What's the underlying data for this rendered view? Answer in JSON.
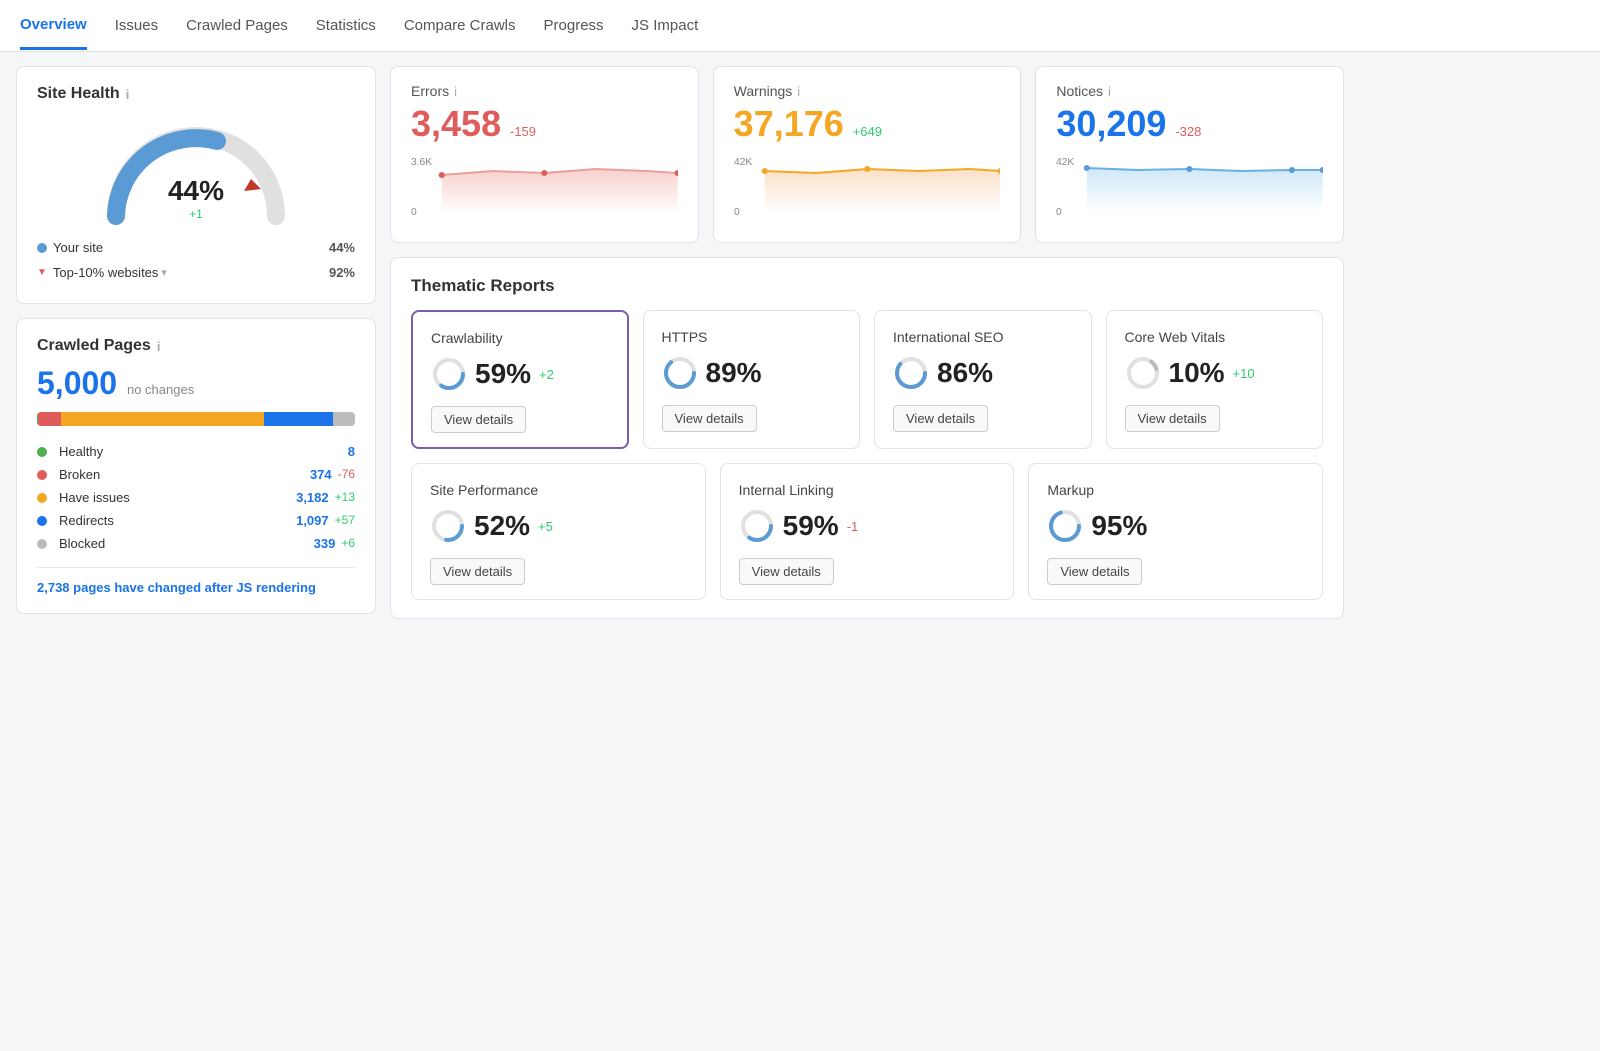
{
  "nav": {
    "items": [
      {
        "label": "Overview",
        "active": true
      },
      {
        "label": "Issues",
        "active": false
      },
      {
        "label": "Crawled Pages",
        "active": false
      },
      {
        "label": "Statistics",
        "active": false
      },
      {
        "label": "Compare Crawls",
        "active": false
      },
      {
        "label": "Progress",
        "active": false
      },
      {
        "label": "JS Impact",
        "active": false
      }
    ]
  },
  "site_health": {
    "title": "Site Health",
    "info": "i",
    "percent": "44%",
    "change": "+1",
    "your_site_label": "Your site",
    "your_site_val": "44%",
    "top10_label": "Top-10% websites",
    "top10_val": "92%"
  },
  "crawled_pages": {
    "title": "Crawled Pages",
    "info": "i",
    "total": "5,000",
    "no_changes": "no changes",
    "stats": [
      {
        "label": "Healthy",
        "color": "#4caf50",
        "value": "8",
        "delta": "",
        "delta_type": ""
      },
      {
        "label": "Broken",
        "color": "#e05c5c",
        "value": "374",
        "delta": "-76",
        "delta_type": "neg"
      },
      {
        "label": "Have issues",
        "color": "#f5a623",
        "value": "3,182",
        "delta": "+13",
        "delta_type": "pos"
      },
      {
        "label": "Redirects",
        "color": "#1a73e8",
        "value": "1,097",
        "delta": "+57",
        "delta_type": "pos"
      },
      {
        "label": "Blocked",
        "color": "#bbb",
        "value": "339",
        "delta": "+6",
        "delta_type": "pos"
      }
    ],
    "changed_text": "2,738 pages",
    "changed_suffix": " have changed after JS rendering"
  },
  "metrics": [
    {
      "label": "Errors",
      "value": "3,458",
      "delta": "-159",
      "delta_type": "neg",
      "type": "errors",
      "chart_max": "3.6K",
      "chart_color": "#f8d0cc",
      "chart_line": "#e8a09a"
    },
    {
      "label": "Warnings",
      "value": "37,176",
      "delta": "+649",
      "delta_type": "pos",
      "type": "warnings",
      "chart_max": "42K",
      "chart_color": "#fae0c8",
      "chart_line": "#f5a623"
    },
    {
      "label": "Notices",
      "value": "30,209",
      "delta": "-328",
      "delta_type": "neg2",
      "type": "notices",
      "chart_max": "42K",
      "chart_color": "#d0e8f8",
      "chart_line": "#6ab0e0"
    }
  ],
  "thematic": {
    "title": "Thematic Reports",
    "reports_top": [
      {
        "name": "Crawlability",
        "pct": "59%",
        "delta": "+2",
        "delta_type": "pos",
        "active": true,
        "score": 59
      },
      {
        "name": "HTTPS",
        "pct": "89%",
        "delta": "",
        "delta_type": "",
        "active": false,
        "score": 89
      },
      {
        "name": "International SEO",
        "pct": "86%",
        "delta": "",
        "delta_type": "",
        "active": false,
        "score": 86
      },
      {
        "name": "Core Web Vitals",
        "pct": "10%",
        "delta": "+10",
        "delta_type": "pos",
        "active": false,
        "score": 10
      }
    ],
    "reports_bottom": [
      {
        "name": "Site Performance",
        "pct": "52%",
        "delta": "+5",
        "delta_type": "pos",
        "active": false,
        "score": 52
      },
      {
        "name": "Internal Linking",
        "pct": "59%",
        "delta": "-1",
        "delta_type": "neg",
        "active": false,
        "score": 59
      },
      {
        "name": "Markup",
        "pct": "95%",
        "delta": "",
        "delta_type": "",
        "active": false,
        "score": 95
      }
    ],
    "view_details": "View details"
  }
}
